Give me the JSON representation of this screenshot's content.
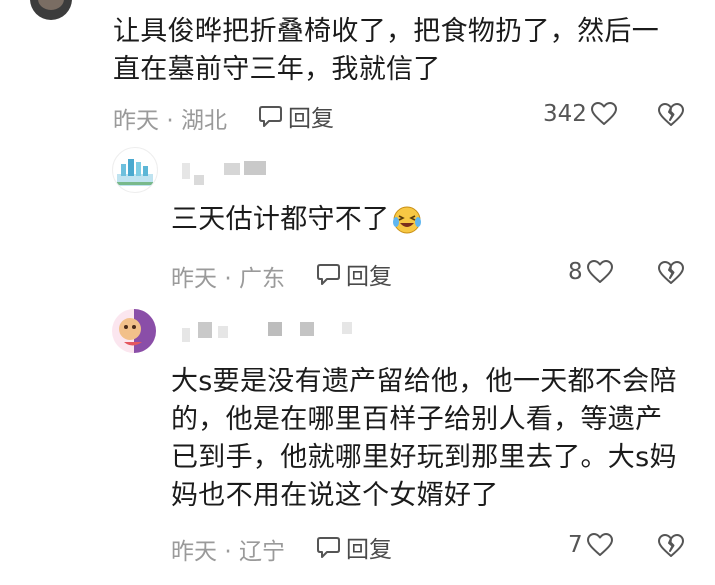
{
  "comments": [
    {
      "lines": [
        "让具俊晔把折叠椅收了，把食物扔了，然后一",
        "直在墓前守三年，我就信了"
      ],
      "date": "昨天",
      "separator": "·",
      "location": "湖北",
      "reply_label": "回复",
      "likes": "342"
    },
    {
      "lines": [
        "三天估计都守不了"
      ],
      "emoji_icon": "crying-laughing-emoji-icon",
      "date": "昨天",
      "separator": "·",
      "location": "广东",
      "reply_label": "回复",
      "likes": "8"
    },
    {
      "lines": [
        "大s要是没有遗产留给他，他一天都不会陪",
        "的，他是在哪里百样子给别人看，等遗产",
        "已到手，他就哪里好玩到那里去了。大s妈",
        "妈也不用在说这个女婿好了"
      ],
      "date": "昨天",
      "separator": "·",
      "location": "辽宁",
      "reply_label": "回复",
      "likes": "7"
    }
  ],
  "icons": {
    "reply": "chat-bubble-icon",
    "like": "heart-outline-icon",
    "dislike": "broken-heart-icon"
  },
  "colors": {
    "text": "#1b1b1b",
    "meta": "#9a9a9a",
    "icon": "#555555"
  }
}
